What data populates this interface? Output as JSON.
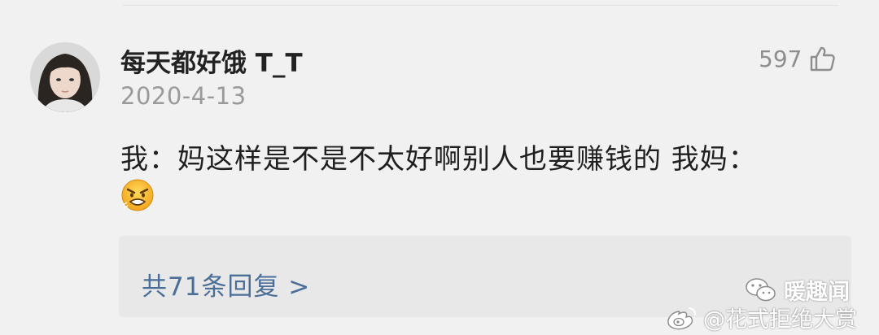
{
  "comment": {
    "username": "每天都好饿 T_T",
    "date": "2020-4-13",
    "likes": "597",
    "text": "我：妈这样是不是不太好啊别人也要赚钱的 我妈：",
    "emoji": "angry-face-emoji",
    "replies_link": "共71条回复 >"
  },
  "watermark": {
    "wechat_account": "暖趣闻",
    "weibo_account": "@花式拒绝大赏"
  },
  "colors": {
    "background": "#f1f1f1",
    "reply_link": "#4a6e98",
    "muted_text": "#9a9a9a",
    "reply_box": "#e8e8e8"
  },
  "icons": [
    "avatar-photo",
    "thumbs-up-icon",
    "angry-face-emoji",
    "wechat-icon",
    "weibo-icon"
  ]
}
